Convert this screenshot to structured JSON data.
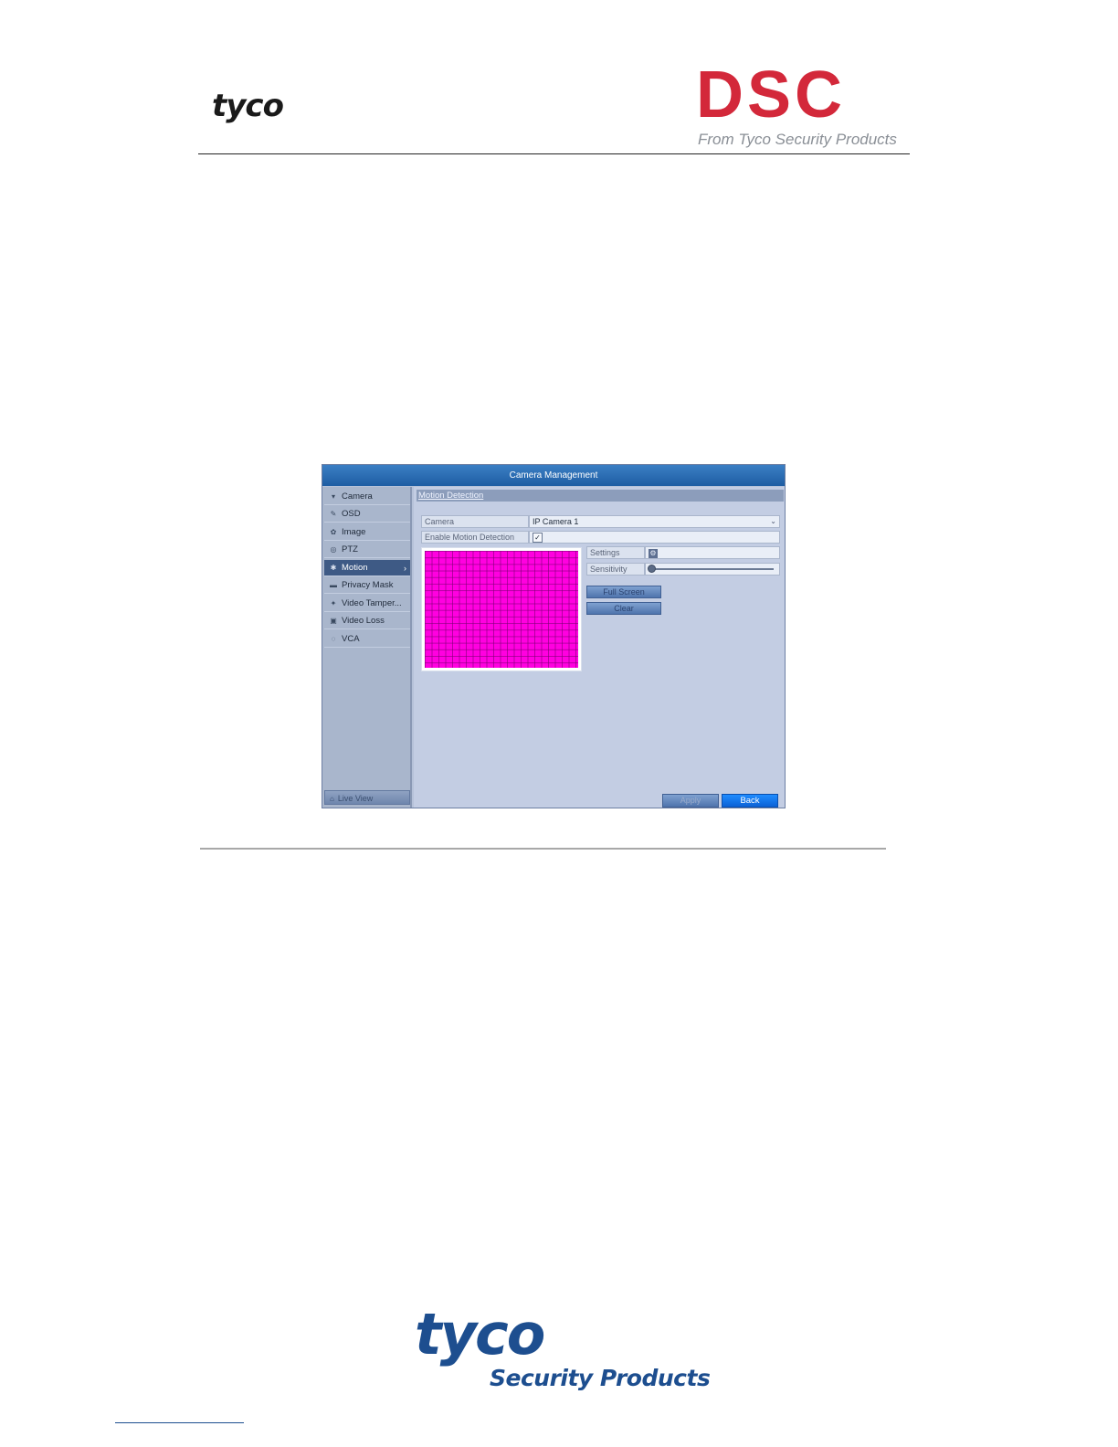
{
  "header": {
    "left_logo": "tyco",
    "right_logo": "DSC",
    "right_tagline": "From Tyco Security Products"
  },
  "window": {
    "title": "Camera Management",
    "sidebar": {
      "items": [
        {
          "label": "Camera",
          "icon": "camera-icon",
          "glyph": "▾"
        },
        {
          "label": "OSD",
          "icon": "osd-icon",
          "glyph": "✎"
        },
        {
          "label": "Image",
          "icon": "image-icon",
          "glyph": "✿"
        },
        {
          "label": "PTZ",
          "icon": "ptz-icon",
          "glyph": "◎"
        },
        {
          "label": "Motion",
          "icon": "motion-icon",
          "glyph": "✱",
          "active": true
        },
        {
          "label": "Privacy Mask",
          "icon": "privacy-mask-icon",
          "glyph": "▬"
        },
        {
          "label": "Video Tamper...",
          "icon": "video-tamper-icon",
          "glyph": "✦"
        },
        {
          "label": "Video Loss",
          "icon": "video-loss-icon",
          "glyph": "▣"
        },
        {
          "label": "VCA",
          "icon": "vca-icon",
          "glyph": "◌"
        }
      ],
      "live_view": "Live View"
    },
    "section_title": "Motion Detection",
    "camera_label": "Camera",
    "camera_value": "IP Camera 1",
    "enable_label": "Enable Motion Detection",
    "enable_checked": "✓",
    "settings_label": "Settings",
    "sensitivity_label": "Sensitivity",
    "sensitivity_level": 0,
    "full_screen_button": "Full Screen",
    "clear_button": "Clear",
    "apply_button": "Apply",
    "back_button": "Back",
    "motion_area_color": "#ff00e0"
  },
  "footer": {
    "logo_main": "tyco",
    "logo_sub": "Security Products"
  }
}
